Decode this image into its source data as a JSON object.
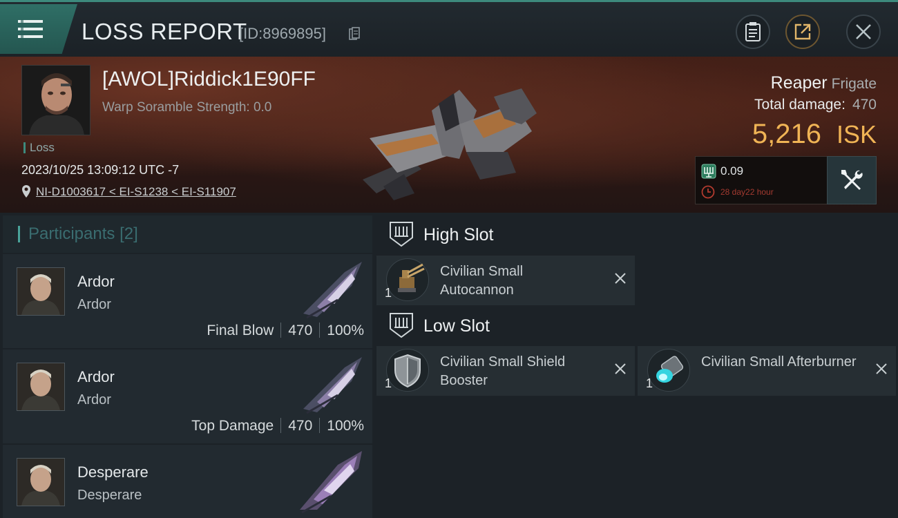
{
  "header": {
    "title": "LOSS REPORT",
    "report_id": "[ID:8969895]",
    "menu_icon": "hamburger-menu-icon",
    "buttons": [
      "clipboard-icon",
      "share-icon",
      "close-icon"
    ],
    "accent_color": "#3d8a7d"
  },
  "victim": {
    "name": "[AWOL]Riddick1E90FF",
    "warp_scramble": "Warp Soramble Strength: 0.0",
    "tag": "Loss",
    "timestamp": "2023/10/25 13:09:12 UTC -7",
    "location": "NI-D1003617 < EI-S1238 < EI-S11907",
    "ship_name": "Reaper",
    "ship_class": "Frigate",
    "total_damage_label": "Total damage:",
    "total_damage": "470",
    "isk_value": "5,216",
    "isk_unit": "ISK",
    "isk_color": "#f0b455",
    "bounty_value": "0.09",
    "bounty_time": "28 day22 hour",
    "fit_button_icon": "wrench-screwdriver-icon"
  },
  "participants": {
    "title": "Participants",
    "count": "[2]",
    "rows": [
      {
        "name": "Ardor",
        "corp": "Ardor",
        "role": "Final Blow",
        "damage": "470",
        "percent": "100%"
      },
      {
        "name": "Ardor",
        "corp": "Ardor",
        "role": "Top Damage",
        "damage": "470",
        "percent": "100%"
      },
      {
        "name": "Desperare",
        "corp": "Desperare"
      }
    ]
  },
  "fitting": {
    "high_slot": {
      "label": "High Slot",
      "modules": [
        {
          "qty": "1",
          "name": "Civilian Small Autocannon",
          "icon": "autocannon-icon"
        }
      ]
    },
    "low_slot": {
      "label": "Low Slot",
      "modules": [
        {
          "qty": "1",
          "name": "Civilian Small Shield Booster",
          "icon": "shield-booster-icon"
        },
        {
          "qty": "1",
          "name": "Civilian Small Afterburner",
          "icon": "afterburner-icon"
        }
      ]
    }
  }
}
